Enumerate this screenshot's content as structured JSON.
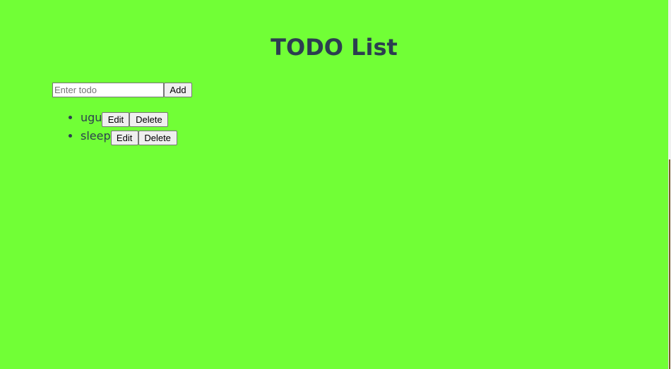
{
  "title": "TODO List",
  "input": {
    "placeholder": "Enter todo",
    "value": ""
  },
  "add_button_label": "Add",
  "todos": [
    {
      "text": "ugu",
      "edit_label": "Edit",
      "delete_label": "Delete"
    },
    {
      "text": "sleep",
      "edit_label": "Edit",
      "delete_label": "Delete"
    }
  ],
  "colors": {
    "background": "#71ff36",
    "text": "#2c3e50"
  }
}
